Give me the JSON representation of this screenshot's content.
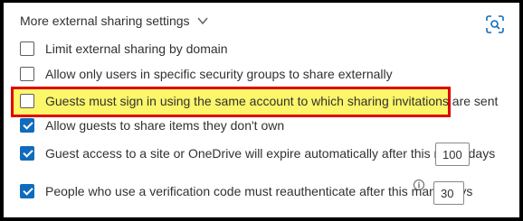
{
  "section": {
    "title": "More external sharing settings",
    "chevron_icon": "chevron-down-icon",
    "lens_icon": "visual-search-icon"
  },
  "options": [
    {
      "label": "Limit external sharing by domain",
      "checked": false
    },
    {
      "label": "Allow only users in specific security groups to share externally",
      "checked": false
    },
    {
      "label": "Guests must sign in using the same account to which sharing invitations are sent",
      "checked": false,
      "highlighted": true
    },
    {
      "label": "Allow guests to share items they don't own",
      "checked": true
    },
    {
      "label": "Guest access to a site or OneDrive will expire automatically after this many days",
      "checked": true,
      "value": "100"
    },
    {
      "label": "People who use a verification code must reauthenticate after this many days",
      "checked": true,
      "value": "30",
      "info_icon": "info-icon"
    }
  ],
  "colors": {
    "accent": "#0f6cbd",
    "highlight_fill": "#fbf66a",
    "highlight_border": "#e00000"
  }
}
